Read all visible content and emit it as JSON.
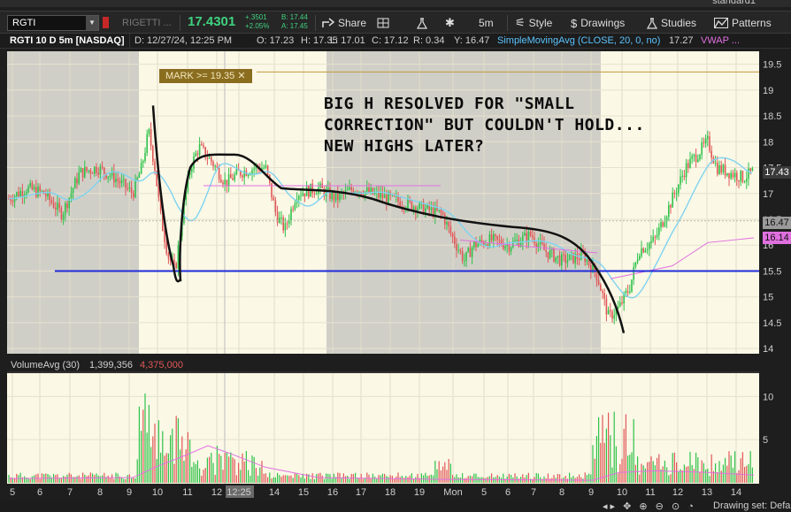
{
  "profile": "standard1",
  "toolbar": {
    "symbol": "RGTI",
    "company": "RIGETTI ...",
    "last": "17.4301",
    "net_change": "+.3501",
    "pct_change": "+2.05%",
    "bid": "B: 17.44",
    "ask": "A: 17.45",
    "share_label": "Share",
    "interval_label": "5m",
    "style_label": "Style",
    "drawings_label": "Drawings",
    "studies_label": "Studies",
    "patterns_label": "Patterns"
  },
  "info": {
    "title": "RGTI 10 D 5m [NASDAQ]",
    "date": "D: 12/27/24, 12:25 PM",
    "open": "O: 17.23",
    "high": "H: 17.35",
    "low": "L: 17.01",
    "close": "C: 17.12",
    "range": "R: 0.34",
    "yest": "Y: 16.47",
    "sma": "SimpleMovingAvg (CLOSE, 20, 0, no)",
    "sma_value": "17.27",
    "vwap": "VWAP ..."
  },
  "volume": {
    "study": "VolumeAvg (30)",
    "avg": "1,399,356",
    "vol": "4,375,000"
  },
  "annotation": {
    "note": "BIG H RESOLVED FOR \"SMALL CORRECTION\" BUT COULDN'T HOLD... NEW HIGHS LATER?",
    "mark_alert": "MARK >= 19.35",
    "mark_close_glyph": "✕"
  },
  "price_axis": {
    "ticks": [
      "19.5",
      "19",
      "18.5",
      "18",
      "17.5",
      "17",
      "16.5",
      "16",
      "15.5",
      "15",
      "14.5",
      "14"
    ],
    "tick_values": [
      19.5,
      19,
      18.5,
      18,
      17.5,
      17,
      16.5,
      16,
      15.5,
      15,
      14.5,
      14
    ],
    "last_tag": "17.43",
    "yest_tag": "16.47",
    "vwap_tag": "16.14"
  },
  "volume_axis": {
    "ticks": [
      "10",
      "5"
    ],
    "tick_values": [
      10,
      5
    ]
  },
  "time_axis": {
    "labels": [
      "5",
      "6",
      "7",
      "8",
      "9",
      "10",
      "11",
      "12",
      "12:25",
      "14",
      "15",
      "16",
      "17",
      "18",
      "19",
      "Mon",
      "5",
      "6",
      "7",
      "8",
      "9",
      "10",
      "11",
      "12",
      "13",
      "14"
    ]
  },
  "horizontal_levels": {
    "support": 15.5,
    "mark_alert": 19.35,
    "yesterday_close": 16.47
  },
  "colors": {
    "chart_bg": "#fbf8e6",
    "session_shade": "#d0cfc7",
    "up": "#2fc24a",
    "down": "#e05757",
    "sma": "#7fd3f0",
    "vwap": "#e070e0",
    "support_line": "#1f2bd8",
    "mark_line": "#c09a3a",
    "green_text": "#3fd27f"
  },
  "bottom": {
    "drawing_set": "Drawing set: Defa"
  }
}
